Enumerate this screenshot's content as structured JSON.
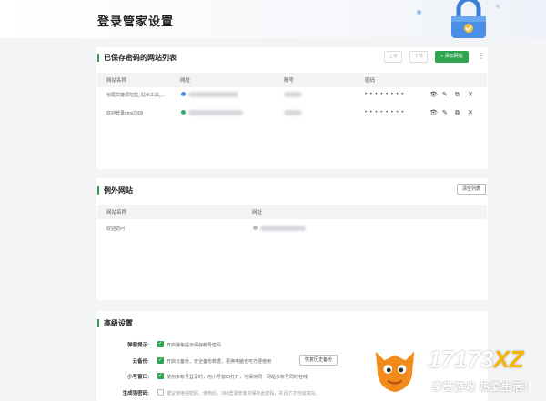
{
  "page": {
    "title": "登录管家设置"
  },
  "saved_section": {
    "title": "已保存密码的网站列表",
    "buttons": {
      "move_up": "上移",
      "move_down": "下移",
      "add_site": "+ 添加网站"
    },
    "columns": [
      "网站名称",
      "网址",
      "账号",
      "密码"
    ],
    "rows": [
      {
        "name": "长尾关键词挖掘_站长工具_...",
        "password": "• • • • • • • •"
      },
      {
        "name": "欢迎登录cms2009",
        "password": "• • • • • • • •"
      }
    ]
  },
  "exception_section": {
    "title": "例外网站",
    "clear_button": "清空列表",
    "columns": [
      "网站名称",
      "网址"
    ],
    "rows": [
      {
        "name": "欢迎访问"
      }
    ]
  },
  "advanced_section": {
    "title": "高级设置",
    "settings": [
      {
        "label": "弹窗提示:",
        "checked": true,
        "text": "开启弹条提示保存帐号密码"
      },
      {
        "label": "云备份:",
        "checked": true,
        "text": "开启云备份，安全备份数据，更换电脑也可方便使用",
        "button": "恢复历史备份"
      },
      {
        "label": "小号窗口:",
        "checked": true,
        "text": "使用多帐号登录时，用小号窗口打开，可保持同一网站多帐号同时在线"
      },
      {
        "label": "生成强密码:",
        "checked": false,
        "text": "建议使用强密码，使用后，360登录管家将保存此密码，并且下次自动填充。"
      }
    ]
  },
  "watermark": {
    "brand_num": "17173",
    "brand_xz": "XZ",
    "slogan": "享受游戏 热爱生活！"
  },
  "colors": {
    "accent": "#2ea44f",
    "lock": "#3c7fd8"
  }
}
